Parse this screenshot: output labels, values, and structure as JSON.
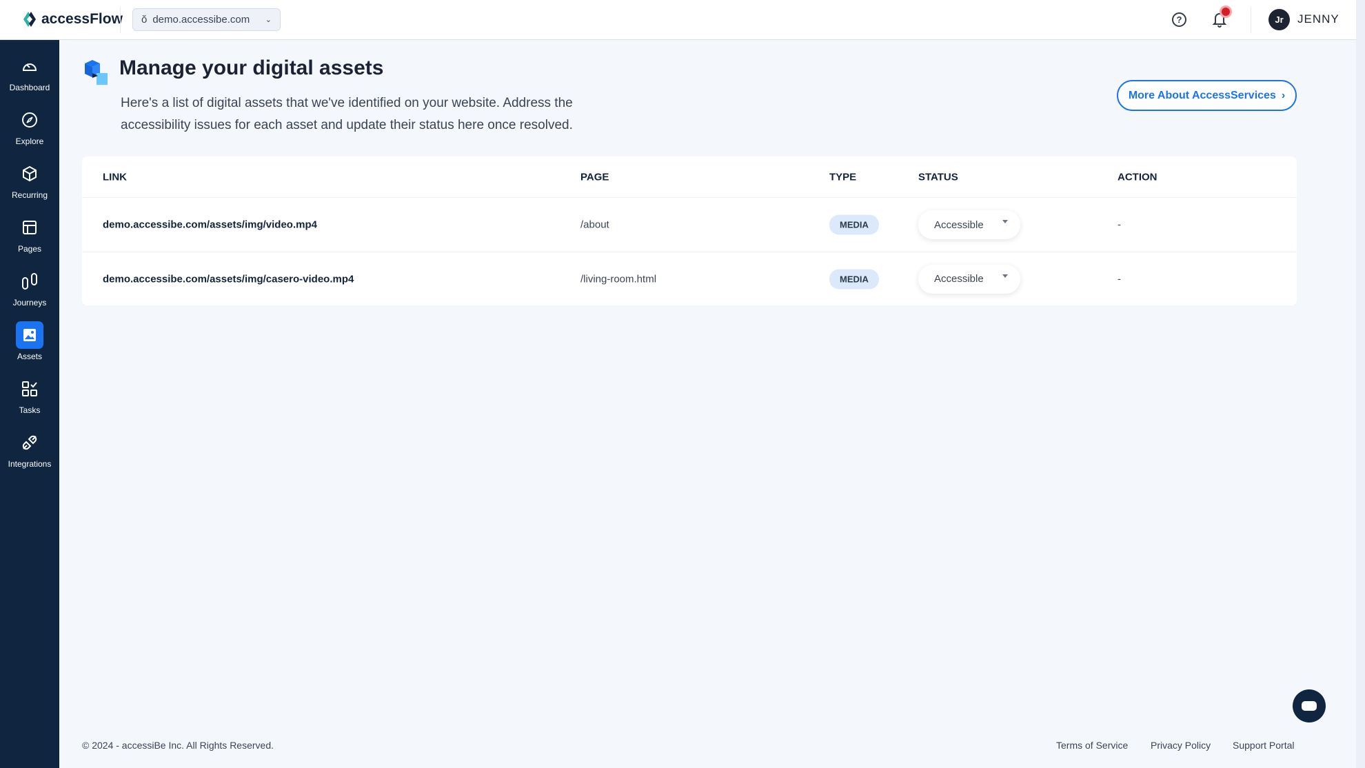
{
  "header": {
    "brand": "accessFlow",
    "domain": "demo.accessibe.com",
    "user_initials": "Jr",
    "user_name": "JENNY"
  },
  "sidebar": {
    "items": [
      {
        "label": "Dashboard",
        "icon": "gauge-icon"
      },
      {
        "label": "Explore",
        "icon": "compass-icon"
      },
      {
        "label": "Recurring",
        "icon": "cube-icon"
      },
      {
        "label": "Pages",
        "icon": "layout-icon"
      },
      {
        "label": "Journeys",
        "icon": "route-icon"
      },
      {
        "label": "Assets",
        "icon": "image-icon",
        "active": true
      },
      {
        "label": "Tasks",
        "icon": "tasks-icon"
      },
      {
        "label": "Integrations",
        "icon": "plug-icon"
      }
    ]
  },
  "main": {
    "title": "Manage your digital assets",
    "description_line1": "Here's a list of digital assets that we've identified on your website. Address the",
    "description_line2": "accessibility issues for each asset and update their status here once resolved.",
    "more_button": "More About AccessServices"
  },
  "table": {
    "headers": [
      "LINK",
      "PAGE",
      "TYPE",
      "STATUS",
      "ACTION"
    ],
    "rows": [
      {
        "link": "demo.accessibe.com/assets/img/video.mp4",
        "page": "/about",
        "type": "MEDIA",
        "status": "Accessible",
        "action": "-"
      },
      {
        "link": "demo.accessibe.com/assets/img/casero-video.mp4",
        "page": "/living-room.html",
        "type": "MEDIA",
        "status": "Accessible",
        "action": "-"
      }
    ]
  },
  "footer": {
    "copyright": "© 2024 - accessiBe Inc. All Rights Reserved.",
    "links": [
      "Terms of Service",
      "Privacy Policy",
      "Support Portal"
    ]
  },
  "colors": {
    "accent": "#1a73f0",
    "sidebar": "#0f2540",
    "badge": "#dce9fb"
  }
}
